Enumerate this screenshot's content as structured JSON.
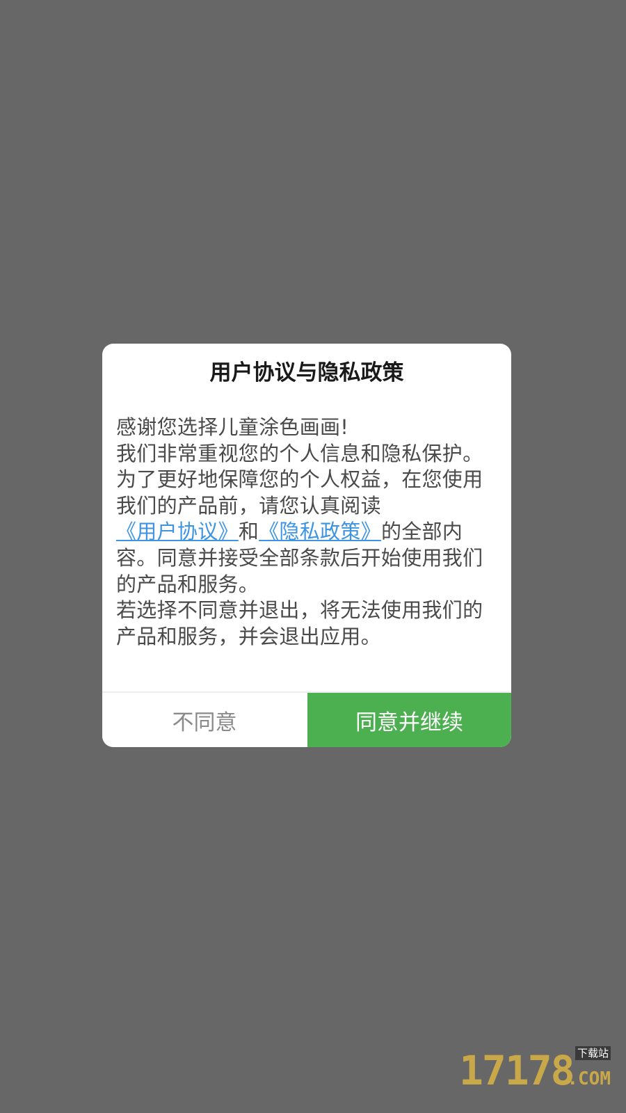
{
  "dialog": {
    "title": "用户协议与隐私政策",
    "body": {
      "line1": "感谢您选择儿童涂色画画!",
      "para2_before": "我们非常重视您的个人信息和隐私保护。为了更好地保障您的个人权益，在您使用我们的产品前，请您认真阅读",
      "link_user_agreement": "《用户协议》",
      "conjunction": "和",
      "link_privacy_policy": "《隐私政策》",
      "para2_after": "的全部内容。同意并接受全部条款后开始使用我们的产品和服务。",
      "para3": "若选择不同意并退出，将无法使用我们的产品和服务，并会退出应用。"
    },
    "buttons": {
      "disagree": "不同意",
      "agree": "同意并继续"
    }
  },
  "colors": {
    "overlay": "#676767",
    "link": "#3d94e3",
    "agree_button": "#4caf50",
    "disagree_text": "#8a8a8a"
  },
  "watermark": {
    "number": "17178",
    "label": "下载站",
    "suffix": ".COM"
  }
}
